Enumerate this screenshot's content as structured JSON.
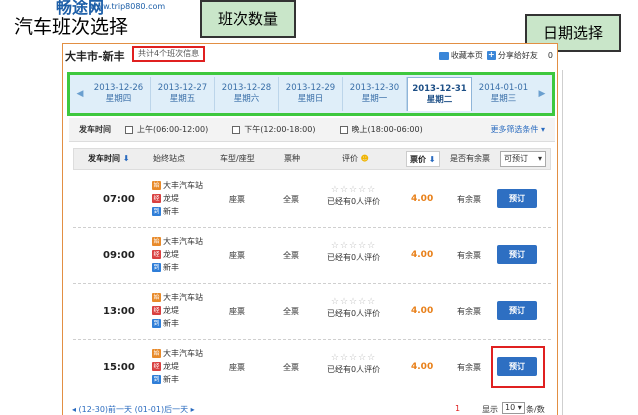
{
  "logo": {
    "mark": "畅途网",
    "url": "www.trip8080.com"
  },
  "page_title": "汽车班次选择",
  "callouts": {
    "count": "班次数量",
    "date": "日期选择"
  },
  "panel": {
    "route": "大丰市-新丰",
    "count_info": "共计4个班次信息",
    "actions": {
      "bookmark": "收藏本页",
      "share": "分享给好友",
      "count": "0"
    }
  },
  "dates": [
    {
      "date": "2013-12-26",
      "weekday": "星期四"
    },
    {
      "date": "2013-12-27",
      "weekday": "星期五"
    },
    {
      "date": "2013-12-28",
      "weekday": "星期六"
    },
    {
      "date": "2013-12-29",
      "weekday": "星期日"
    },
    {
      "date": "2013-12-30",
      "weekday": "星期一"
    },
    {
      "date": "2013-12-31",
      "weekday": "星期二"
    },
    {
      "date": "2014-01-01",
      "weekday": "星期三"
    }
  ],
  "active_date_index": 5,
  "filters": {
    "label": "发车时间",
    "options": [
      "上午(06:00-12:00)",
      "下午(12:00-18:00)",
      "晚上(18:00-06:00)"
    ],
    "more": "更多筛选条件"
  },
  "table": {
    "headers": {
      "depart_time": "发车时间",
      "stations": "始终站点",
      "bus_type": "车型/座型",
      "ticket_type": "票种",
      "rating": "评价",
      "price": "票价",
      "remain": "是否有余票",
      "bookable": "可预订"
    },
    "rows": [
      {
        "time": "07:00",
        "start": "大丰汽车站",
        "via": "龙堤",
        "end": "新丰",
        "seat": "座票",
        "ticket": "全票",
        "rating_text": "已经有0人评价",
        "price": "4.00",
        "remain": "有余票",
        "action": "预订"
      },
      {
        "time": "09:00",
        "start": "大丰汽车站",
        "via": "龙堤",
        "end": "新丰",
        "seat": "座票",
        "ticket": "全票",
        "rating_text": "已经有0人评价",
        "price": "4.00",
        "remain": "有余票",
        "action": "预订"
      },
      {
        "time": "13:00",
        "start": "大丰汽车站",
        "via": "龙堤",
        "end": "新丰",
        "seat": "座票",
        "ticket": "全票",
        "rating_text": "已经有0人评价",
        "price": "4.00",
        "remain": "有余票",
        "action": "预订"
      },
      {
        "time": "15:00",
        "start": "大丰汽车站",
        "via": "龙堤",
        "end": "新丰",
        "seat": "座票",
        "ticket": "全票",
        "rating_text": "已经有0人评价",
        "price": "4.00",
        "remain": "有余票",
        "action": "预订"
      }
    ],
    "badges": {
      "start": "始",
      "via": "经",
      "end": "到"
    },
    "stars": "☆☆☆☆☆"
  },
  "footer": {
    "prev_next": "◂ (12-30)前一天  (01-01)后一天 ▸",
    "page": "1",
    "show_label": "显示",
    "per_page": "10",
    "unit": "条/数"
  },
  "colors": {
    "accent_orange": "#e28f43",
    "highlight_red": "#e02020",
    "date_highlight_green": "#3ec83e",
    "button_blue": "#2e6fc2",
    "price_orange": "#e8801a"
  }
}
